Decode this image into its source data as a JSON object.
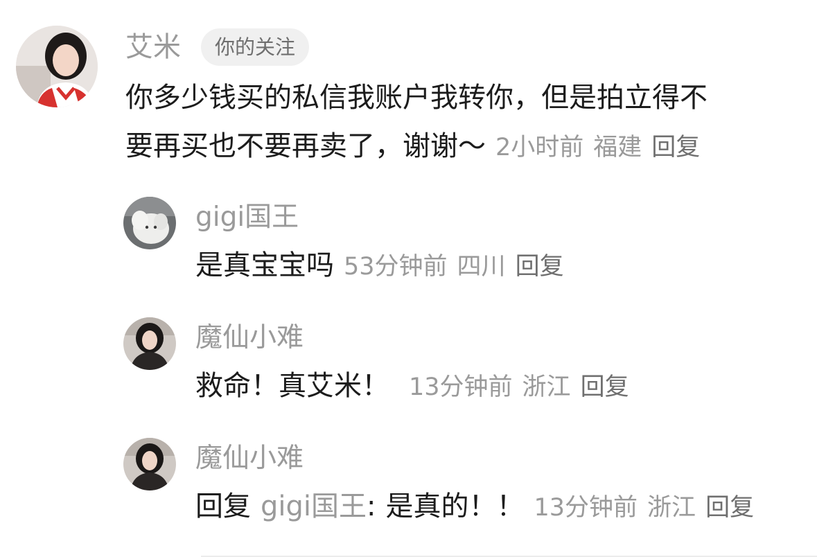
{
  "colors": {
    "text_primary": "#1c1c1c",
    "text_secondary": "#9a9a9a",
    "badge_bg": "#f0f0f0"
  },
  "main_comment": {
    "username": "艾米",
    "badge": "你的关注",
    "text_line1": "你多少钱买的私信我账户我转你，但是拍立得不",
    "text_line2": "要再买也不要再卖了，谢谢～",
    "time": "2小时前",
    "location": "福建",
    "reply_label": "回复",
    "avatar_icon": "user-avatar-photo"
  },
  "replies": [
    {
      "username": "gigi国王",
      "text": "是真宝宝吗",
      "time": "53分钟前",
      "location": "四川",
      "reply_label": "回复",
      "avatar_icon": "white-dog-avatar"
    },
    {
      "username": "魔仙小难",
      "text": "救命！真艾米！",
      "time": "13分钟前",
      "location": "浙江",
      "reply_label": "回复",
      "avatar_icon": "user-avatar-photo"
    },
    {
      "username": "魔仙小难",
      "reply_prefix": "回复",
      "reply_to": "gigi国王",
      "separator": ":",
      "text": "是真的！！",
      "time": "13分钟前",
      "location": "浙江",
      "reply_label": "回复",
      "avatar_icon": "user-avatar-photo"
    }
  ]
}
